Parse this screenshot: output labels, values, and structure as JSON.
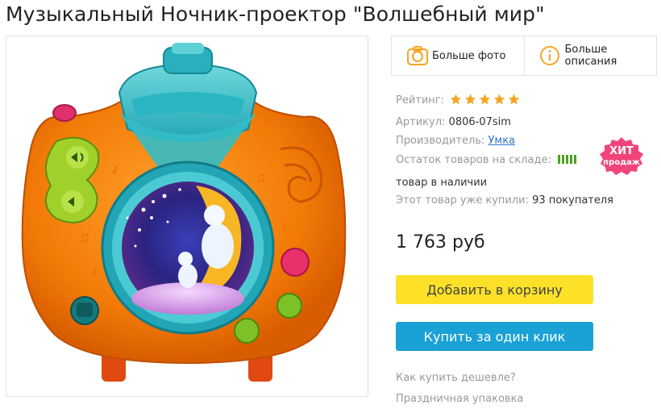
{
  "product": {
    "title": "Музыкальный Ночник-проектор \"Волшебный мир\""
  },
  "info_buttons": {
    "more_photo": "Больше фото",
    "more_description": "Больше описания"
  },
  "props": {
    "rating_label": "Рейтинг:",
    "rating_value": 5,
    "rating_max": 5,
    "sku_label": "Артикул:",
    "sku_value": "0806-07sim",
    "manufacturer_label": "Производитель:",
    "manufacturer_value": "Умка",
    "stock_label": "Остаток товаров на складе:",
    "stock_level": 5,
    "stock_max": 5,
    "availability": "товар в наличии",
    "bought_label": "Этот товар уже купили:",
    "bought_value": "93 покупателя"
  },
  "badge": {
    "line1": "ХИТ",
    "line2": "продаж"
  },
  "price": "1 763  руб",
  "buttons": {
    "add_to_cart": "Добавить в корзину",
    "one_click": "Купить за один клик"
  },
  "links": {
    "cheaper": "Как купить дешевле?",
    "gift_wrap": "Праздничная упаковка"
  },
  "colors": {
    "accent_yellow": "#fce128",
    "accent_blue": "#1aa2d6",
    "star_orange": "#f5a623",
    "badge_pink": "#f0447a",
    "stock_green": "#4aa21e",
    "link_blue": "#2a73c8"
  }
}
